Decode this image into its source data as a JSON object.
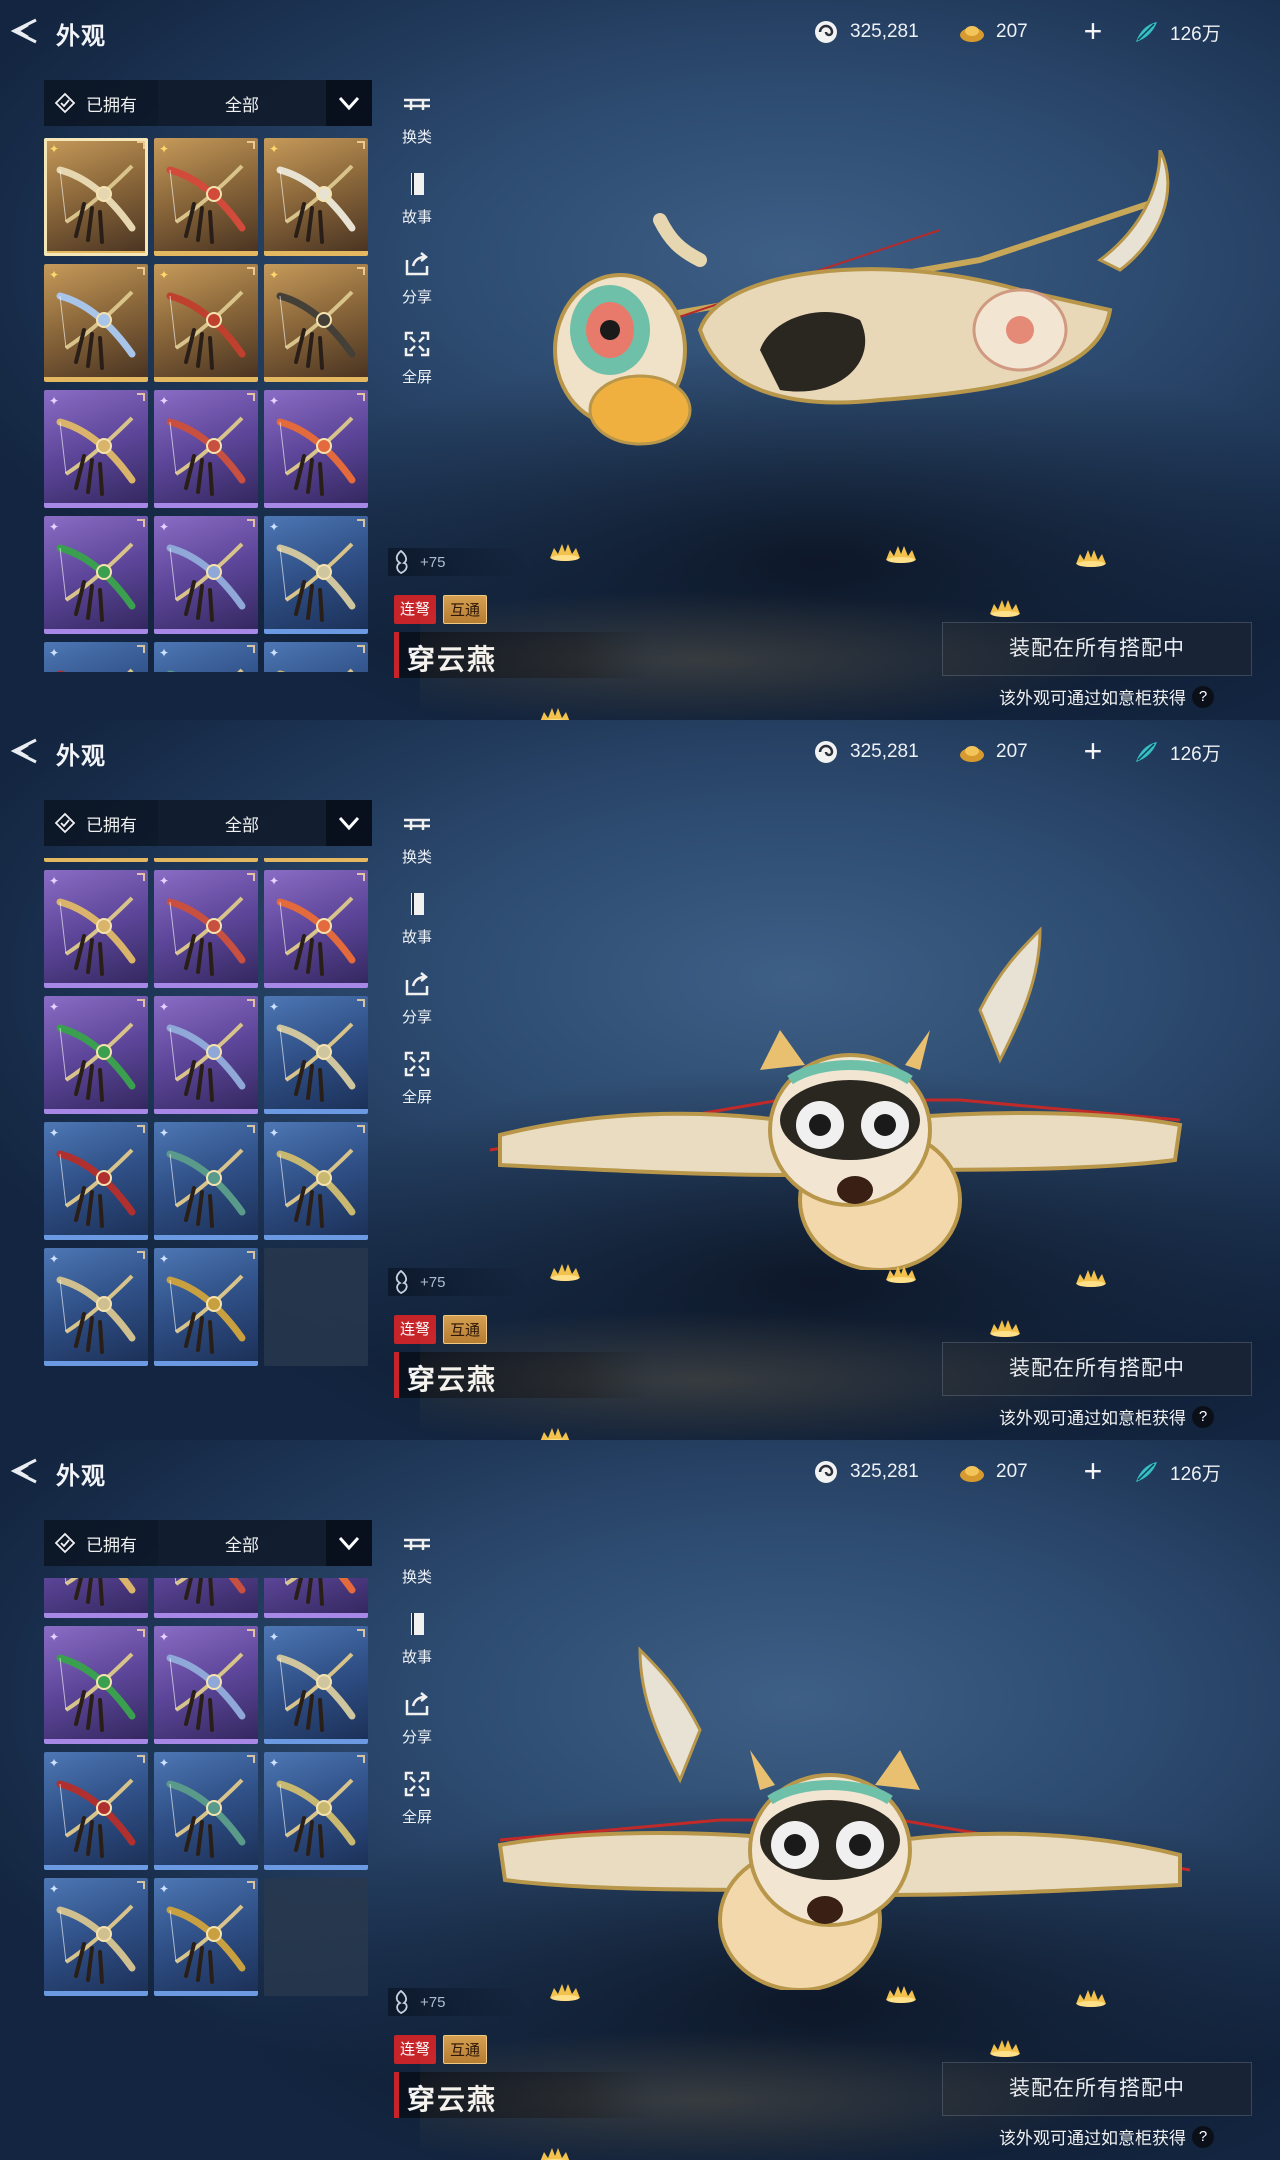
{
  "header": {
    "title": "外观",
    "currencies": [
      {
        "icon": "shell-currency-icon",
        "value": "325,281"
      },
      {
        "icon": "gold-ingot-icon",
        "value": "207"
      },
      {
        "icon": "jade-feather-icon",
        "value": "126万"
      }
    ],
    "plus": "+"
  },
  "filter": {
    "owned_label": "已拥有",
    "category_label": "全部"
  },
  "side_menu": [
    {
      "icon": "switch-type-icon",
      "label": "换类"
    },
    {
      "icon": "story-book-icon",
      "label": "故事"
    },
    {
      "icon": "share-icon",
      "label": "分享"
    },
    {
      "icon": "fullscreen-icon",
      "label": "全屏"
    }
  ],
  "item": {
    "power": "+75",
    "tags": [
      "连弩",
      "互通"
    ],
    "name": "穿云燕"
  },
  "actions": {
    "equip_all": "装配在所有搭配中",
    "source_hint": "该外观可通过如意柜获得",
    "help": "?"
  },
  "grid": {
    "rarity_mark": {
      "gold": "✦",
      "purple": "✦",
      "blue": "✦"
    },
    "tiles": [
      {
        "rarity": "gold",
        "selected": true
      },
      {
        "rarity": "gold"
      },
      {
        "rarity": "gold"
      },
      {
        "rarity": "gold"
      },
      {
        "rarity": "gold"
      },
      {
        "rarity": "gold"
      },
      {
        "rarity": "purple"
      },
      {
        "rarity": "purple"
      },
      {
        "rarity": "purple"
      },
      {
        "rarity": "purple"
      },
      {
        "rarity": "purple"
      },
      {
        "rarity": "blue"
      },
      {
        "rarity": "blue"
      },
      {
        "rarity": "blue"
      },
      {
        "rarity": "blue"
      },
      {
        "rarity": "blue"
      },
      {
        "rarity": "blue"
      },
      {
        "rarity": "empty"
      }
    ]
  },
  "colors": {
    "accent_red": "#c7242a",
    "rarity_gold": "#e3b860",
    "rarity_purple": "#a888e6",
    "rarity_blue": "#6b9ae2"
  },
  "views": [
    "side-angled",
    "front-tilted-left",
    "front-tilted-right"
  ]
}
